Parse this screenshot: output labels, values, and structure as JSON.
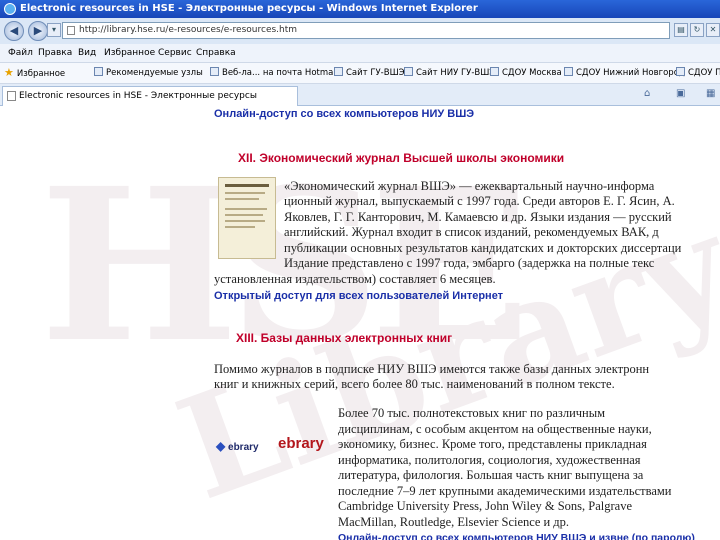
{
  "window": {
    "title": "Electronic resources in HSE - Электронные ресурсы - Windows Internet Explorer"
  },
  "address": {
    "url": "http://library.hse.ru/e-resources/e-resources.htm"
  },
  "menu": [
    "Файл",
    "Правка",
    "Вид",
    "Избранное",
    "Сервис",
    "Справка"
  ],
  "favorites": {
    "label": "Избранное",
    "items": [
      "Рекомендуемые узлы",
      "Веб-ла... на почта Hotmail",
      "Сайт ГУ-ВШЭ",
      "Сайт НИУ ГУ-ВШЭ",
      "СДОУ Москва",
      "СДОУ Нижний Новгород",
      "СДОУ П"
    ]
  },
  "tab": {
    "label": "Electronic resources in HSE - Электронные ресурсы"
  },
  "content": {
    "top_link": "Онлайн-доступ со всех компьютеров НИУ ВШЭ",
    "section12": {
      "heading": "XII. Экономический журнал Высшей школы экономики",
      "lines": [
        "«Экономический журнал ВШЭ» — ежеквартальный научно-информа",
        "ционный журнал, выпускаемый с 1997 года. Среди авторов Е. Г. Ясин, А.",
        "Яковлев, Г. Г. Канторович, М. Камаевсю и др. Языки издания — русский",
        "английский. Журнал входит в список изданий, рекомендуемых ВАК, д",
        "публикации основных результатов кандидатских и докторских диссертаци",
        "Издание представлено с 1997 года, эмбарго (задержка на полные текс",
        "установленная издательством) составляет 6 месяцев."
      ],
      "access": "Открытый доступ для всех пользователей Интернет"
    },
    "section13": {
      "heading": "XIII. Базы данных электронных книг",
      "intro": [
        "Помимо журналов в подписке НИУ ВШЭ имеются также базы данных электронн",
        "книг и книжных серий, всего более 80 тыс. наименований в полном тексте."
      ]
    },
    "ebrary": {
      "logo_small": "ebrary",
      "logo_big": "ebrary",
      "lines": [
        "Более 70 тыс. полнотекстовых книг по различным",
        "дисциплинам, с особым акцентом на общественные науки,",
        "экономику, бизнес. Кроме того, представлены прикладная",
        "информатика, политология, социология, художественная",
        "литература, филология. Большая часть книг выпущена за",
        "последние 7–9 лет крупными академическими издательствами",
        "Cambridge University Press, John Wiley & Sons, Palgrave",
        "MacMillan, Routledge, Elsevier Science и др."
      ],
      "access": "Онлайн-доступ со всех компьютеров НИУ ВШЭ и извне (по паролю)"
    }
  }
}
